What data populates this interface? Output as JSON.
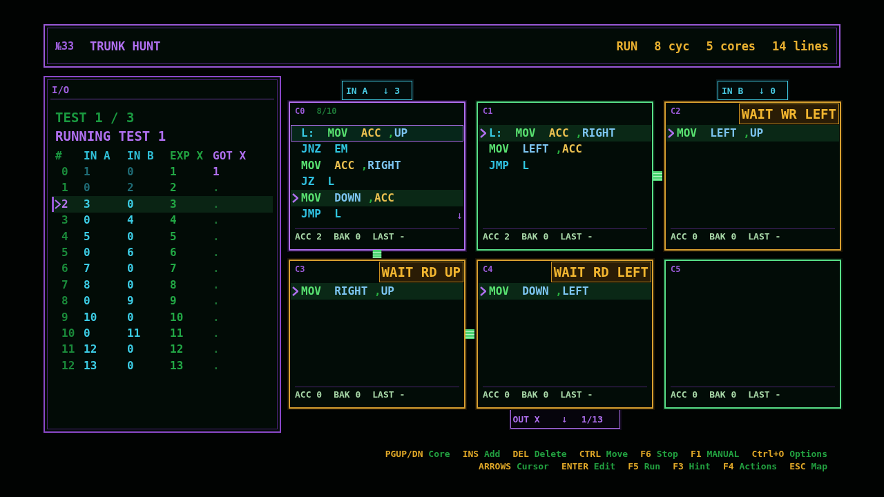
{
  "header": {
    "level_id": "№33",
    "title": "TRUNK HUNT",
    "stats": [
      "RUN",
      "8 cyc",
      "5 cores",
      "14 lines"
    ]
  },
  "io_panel": {
    "title": "I/O",
    "test_number": "TEST 1 / 3",
    "status": "RUNNING TEST 1",
    "columns": [
      {
        "label": "#",
        "kind": "index"
      },
      {
        "label": "IN A",
        "kind": "input"
      },
      {
        "label": "IN B",
        "kind": "input"
      },
      {
        "label": "EXP X",
        "kind": "expected"
      },
      {
        "label": "GOT X",
        "kind": "output"
      }
    ],
    "rows": [
      {
        "selected": false,
        "consumed": true,
        "received": true,
        "cells": [
          "0",
          "1",
          "0",
          "1",
          "1"
        ]
      },
      {
        "selected": false,
        "consumed": true,
        "received": false,
        "cells": [
          "1",
          "0",
          "2",
          "2",
          "."
        ]
      },
      {
        "selected": true,
        "consumed": false,
        "received": false,
        "cells": [
          "2",
          "3",
          "0",
          "3",
          "."
        ]
      },
      {
        "selected": false,
        "consumed": false,
        "received": false,
        "cells": [
          "3",
          "0",
          "4",
          "4",
          "."
        ]
      },
      {
        "selected": false,
        "consumed": false,
        "received": false,
        "cells": [
          "4",
          "5",
          "0",
          "5",
          "."
        ]
      },
      {
        "selected": false,
        "consumed": false,
        "received": false,
        "cells": [
          "5",
          "0",
          "6",
          "6",
          "."
        ]
      },
      {
        "selected": false,
        "consumed": false,
        "received": false,
        "cells": [
          "6",
          "7",
          "0",
          "7",
          "."
        ]
      },
      {
        "selected": false,
        "consumed": false,
        "received": false,
        "cells": [
          "7",
          "8",
          "0",
          "8",
          "."
        ]
      },
      {
        "selected": false,
        "consumed": false,
        "received": false,
        "cells": [
          "8",
          "0",
          "9",
          "9",
          "."
        ]
      },
      {
        "selected": false,
        "consumed": false,
        "received": false,
        "cells": [
          "9",
          "10",
          "0",
          "10",
          "."
        ]
      },
      {
        "selected": false,
        "consumed": false,
        "received": false,
        "cells": [
          "10",
          "0",
          "11",
          "11",
          "."
        ]
      },
      {
        "selected": false,
        "consumed": false,
        "received": false,
        "cells": [
          "11",
          "12",
          "0",
          "12",
          "."
        ]
      },
      {
        "selected": false,
        "consumed": false,
        "received": false,
        "cells": [
          "12",
          "13",
          "0",
          "13",
          "."
        ]
      }
    ]
  },
  "cores": [
    {
      "name": "C0",
      "info": "8/10",
      "selected": true,
      "port": {
        "kind": "input",
        "label": "IN A",
        "arrow": "↓",
        "value": "3"
      },
      "lines": [
        {
          "selected": true,
          "current": false,
          "tokens": [
            {
              "text": "L:",
              "kind": "label"
            },
            {
              "text": "MOV",
              "kind": "op"
            },
            {
              "text": "ACC",
              "kind": "reg"
            },
            {
              "text": ",",
              "kind": "comma"
            },
            {
              "text": "UP",
              "kind": "port"
            }
          ]
        },
        {
          "selected": false,
          "current": false,
          "tokens": [
            {
              "text": "JNZ",
              "kind": "jump"
            },
            {
              "text": "EM",
              "kind": "target"
            }
          ]
        },
        {
          "selected": false,
          "current": false,
          "tokens": [
            {
              "text": "MOV",
              "kind": "op"
            },
            {
              "text": "ACC",
              "kind": "reg"
            },
            {
              "text": ",",
              "kind": "comma"
            },
            {
              "text": "RIGHT",
              "kind": "port"
            }
          ]
        },
        {
          "selected": false,
          "current": false,
          "tokens": [
            {
              "text": "JZ",
              "kind": "jump"
            },
            {
              "text": "L",
              "kind": "target"
            }
          ]
        },
        {
          "selected": false,
          "current": true,
          "tokens": [
            {
              "text": "MOV",
              "kind": "op"
            },
            {
              "text": "DOWN",
              "kind": "port"
            },
            {
              "text": ",",
              "kind": "comma"
            },
            {
              "text": "ACC",
              "kind": "reg"
            }
          ]
        },
        {
          "selected": false,
          "current": false,
          "tokens": [
            {
              "text": "JMP",
              "kind": "jump"
            },
            {
              "text": "L",
              "kind": "target"
            }
          ]
        }
      ],
      "scroll_hint": "↓",
      "registers": [
        "ACC 2",
        "BAK 0",
        "LAST -"
      ],
      "signal_right": false,
      "signal_down": true
    },
    {
      "name": "C1",
      "selected": false,
      "lines": [
        {
          "selected": false,
          "current": true,
          "tokens": [
            {
              "text": "L:",
              "kind": "label"
            },
            {
              "text": "MOV",
              "kind": "op"
            },
            {
              "text": "ACC",
              "kind": "reg"
            },
            {
              "text": ",",
              "kind": "comma"
            },
            {
              "text": "RIGHT",
              "kind": "port"
            }
          ]
        },
        {
          "selected": false,
          "current": false,
          "tokens": [
            {
              "text": "MOV",
              "kind": "op"
            },
            {
              "text": "LEFT",
              "kind": "port"
            },
            {
              "text": ",",
              "kind": "comma"
            },
            {
              "text": "ACC",
              "kind": "reg"
            }
          ]
        },
        {
          "selected": false,
          "current": false,
          "tokens": [
            {
              "text": "JMP",
              "kind": "jump"
            },
            {
              "text": "L",
              "kind": "target"
            }
          ]
        }
      ],
      "registers": [
        "ACC 2",
        "BAK 0",
        "LAST -"
      ],
      "signal_right": true,
      "signal_down": false
    },
    {
      "name": "C2",
      "selected": false,
      "status": "WAIT WR LEFT",
      "port": {
        "kind": "input",
        "label": "IN B",
        "arrow": "↓",
        "value": "0"
      },
      "lines": [
        {
          "selected": false,
          "current": true,
          "tokens": [
            {
              "text": "MOV",
              "kind": "op"
            },
            {
              "text": "LEFT",
              "kind": "port"
            },
            {
              "text": ",",
              "kind": "comma"
            },
            {
              "text": "UP",
              "kind": "port"
            }
          ]
        }
      ],
      "registers": [
        "ACC 0",
        "BAK 0",
        "LAST -"
      ],
      "signal_right": false,
      "signal_down": false
    },
    {
      "name": "C3",
      "selected": false,
      "status": "WAIT RD UP",
      "lines": [
        {
          "selected": false,
          "current": true,
          "tokens": [
            {
              "text": "MOV",
              "kind": "op"
            },
            {
              "text": "RIGHT",
              "kind": "port"
            },
            {
              "text": ",",
              "kind": "comma"
            },
            {
              "text": "UP",
              "kind": "port"
            }
          ]
        }
      ],
      "registers": [
        "ACC 0",
        "BAK 0",
        "LAST -"
      ],
      "signal_right": true,
      "signal_down": false
    },
    {
      "name": "C4",
      "selected": false,
      "status": "WAIT RD LEFT",
      "port": {
        "kind": "output",
        "label": "OUT X",
        "arrow": "↓",
        "value": "1/13"
      },
      "lines": [
        {
          "selected": false,
          "current": true,
          "tokens": [
            {
              "text": "MOV",
              "kind": "op"
            },
            {
              "text": "DOWN",
              "kind": "port"
            },
            {
              "text": ",",
              "kind": "comma"
            },
            {
              "text": "LEFT",
              "kind": "port"
            }
          ]
        }
      ],
      "registers": [
        "ACC 0",
        "BAK 0",
        "LAST -"
      ],
      "signal_right": false,
      "signal_down": false
    },
    {
      "name": "C5",
      "selected": false,
      "registers": [
        "ACC 0",
        "BAK 0",
        "LAST -"
      ],
      "signal_right": false,
      "signal_down": false
    }
  ],
  "key_hints": [
    {
      "items": [
        {
          "key": "PGUP/DN",
          "action": "Core"
        },
        {
          "key": "INS",
          "action": "Add"
        },
        {
          "key": "DEL",
          "action": "Delete"
        },
        {
          "key": "CTRL",
          "action": "Move"
        },
        {
          "key": "F6",
          "action": "Stop"
        },
        {
          "key": "F1",
          "action": "MANUAL"
        },
        {
          "key": "Ctrl+O",
          "action": "Options"
        }
      ]
    },
    {
      "items": [
        {
          "key": "ARROWS",
          "action": "Cursor"
        },
        {
          "key": "ENTER",
          "action": "Edit"
        },
        {
          "key": "F5",
          "action": "Run"
        },
        {
          "key": "F3",
          "action": "Hint"
        },
        {
          "key": "F4",
          "action": "Actions"
        },
        {
          "key": "ESC",
          "action": "Map"
        }
      ]
    }
  ]
}
